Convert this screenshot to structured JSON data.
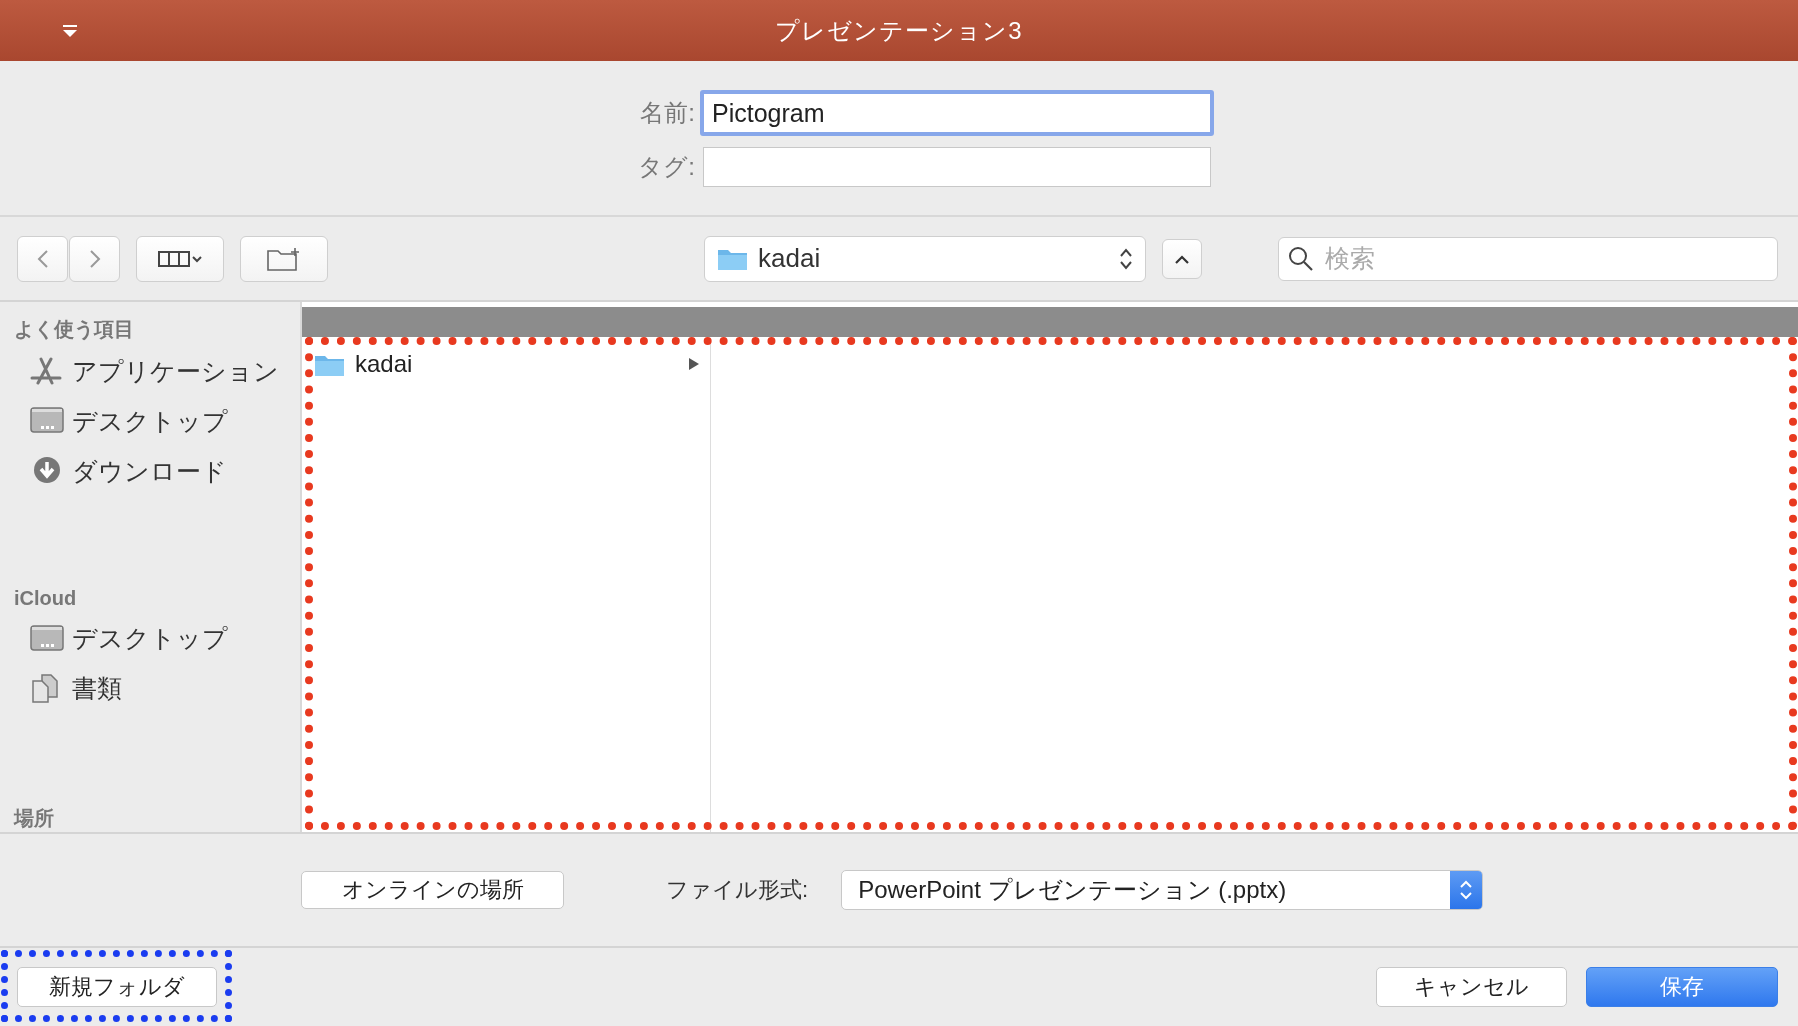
{
  "window": {
    "title": "プレゼンテーション3"
  },
  "form": {
    "name_label": "名前:",
    "name_value": "Pictogram",
    "tag_label": "タグ:"
  },
  "toolbar": {
    "location": "kadai",
    "search_placeholder": "検索"
  },
  "sidebar": {
    "sections": [
      {
        "heading": "よく使う項目",
        "items": [
          {
            "label": "アプリケーション",
            "kind": "apps"
          },
          {
            "label": "デスクトップ",
            "kind": "desktop"
          },
          {
            "label": "ダウンロード",
            "kind": "download"
          }
        ]
      },
      {
        "heading": "iCloud",
        "items": [
          {
            "label": "デスクトップ",
            "kind": "desktop"
          },
          {
            "label": "書類",
            "kind": "documents"
          }
        ]
      },
      {
        "heading": "場所"
      }
    ]
  },
  "browser": {
    "column_1": [
      {
        "name": "kadai",
        "kind": "folder"
      }
    ]
  },
  "options": {
    "online_button": "オンラインの場所",
    "format_label": "ファイル形式:",
    "format_value": "PowerPoint プレゼンテーション (.pptx)"
  },
  "footer": {
    "left_button": "新規フォルダ",
    "buttons": [
      {
        "label": "キャンセル",
        "kind": "normal"
      },
      {
        "label": "保存",
        "kind": "default"
      }
    ]
  },
  "annotations": {
    "browser_frame": {
      "color": "#e8391f"
    },
    "new_folder_frame": {
      "color": "#1a3cf0"
    }
  }
}
